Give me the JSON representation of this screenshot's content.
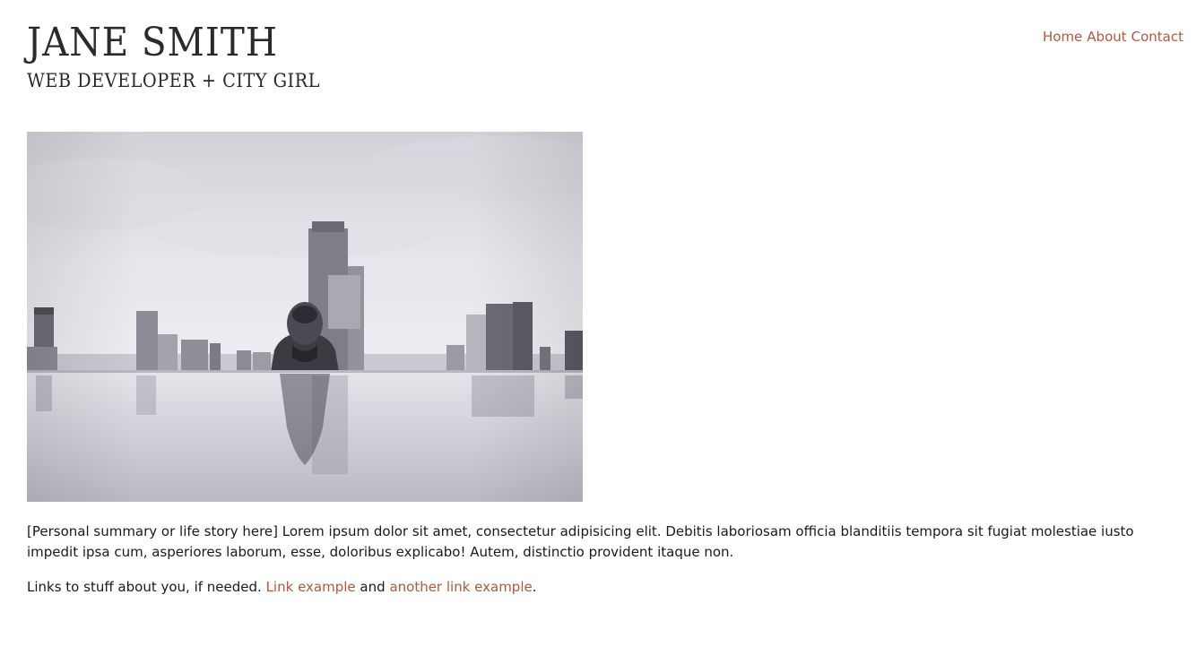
{
  "header": {
    "title": "JANE SMITH",
    "tagline": "WEB DEVELOPER + CITY GIRL"
  },
  "nav": {
    "home": "Home",
    "about": "About",
    "contact": "Contact"
  },
  "hero": {
    "description": "Person in infinity pool looking up, city skyline in background"
  },
  "content": {
    "summary": "[Personal summary or life story here] Lorem ipsum dolor sit amet, consectetur adipisicing elit. Debitis laboriosam officia blanditiis tempora sit fugiat molestiae iusto impedit ipsa cum, asperiores laborum, esse, doloribus explicabo! Autem, distinctio provident itaque non.",
    "links_intro": "Links to stuff about you, if needed.",
    "link1": "Link example",
    "connector": "and",
    "link2": "another link example",
    "end": "."
  },
  "colors": {
    "accent": "#b0593b",
    "text": "#1a1a1a"
  }
}
